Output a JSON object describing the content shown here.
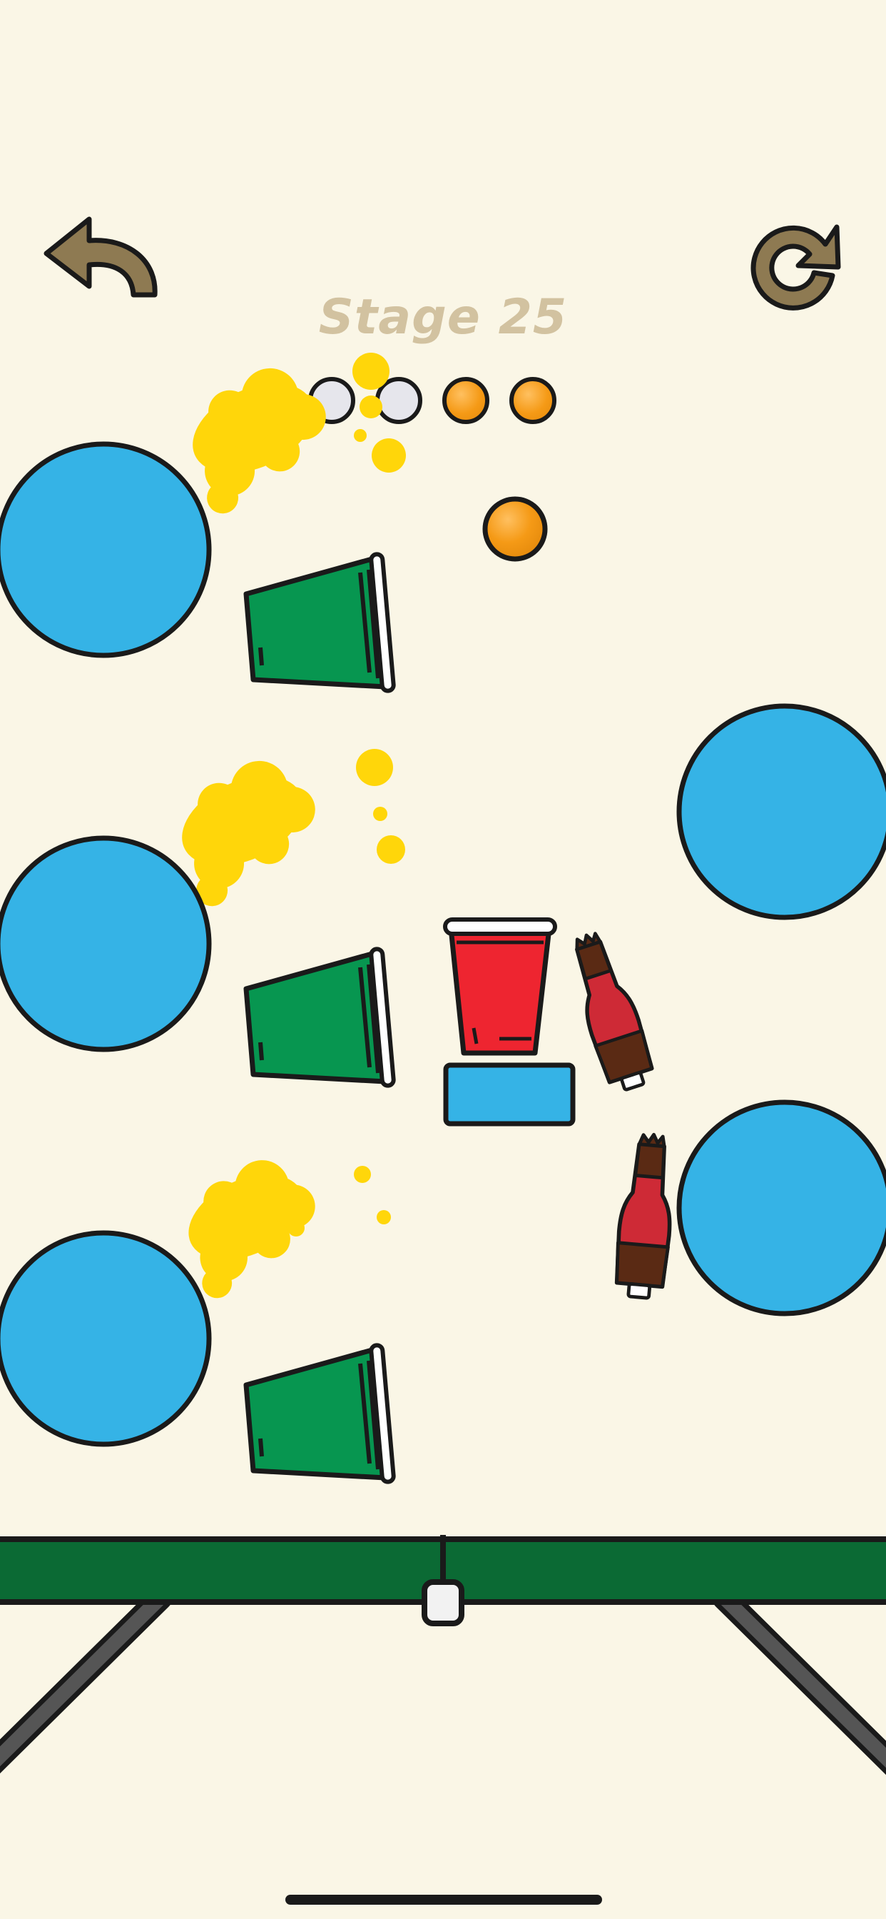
{
  "stage": {
    "label": "Stage 25"
  },
  "balls": {
    "total": 4,
    "used": 2,
    "remaining": 2
  },
  "controls": {
    "back_icon": "curved-arrow-back-icon",
    "restart_icon": "circular-arrow-restart-icon"
  },
  "colors": {
    "background": "#faf6e6",
    "bumper_blue": "#35b3e6",
    "cup_green": "#079650",
    "cup_red": "#ee2530",
    "splash_yellow": "#ffd60a",
    "ball_orange": "#f59a16",
    "table_green": "#0b6a34",
    "stage_text": "#d2c2a0",
    "control_brown": "#8e7a52"
  }
}
